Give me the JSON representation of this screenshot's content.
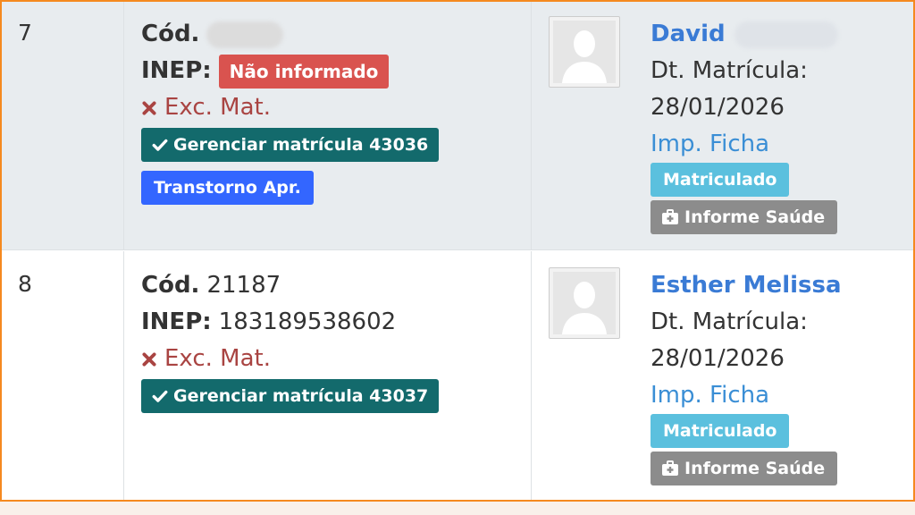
{
  "rows": [
    {
      "index": "7",
      "cod_label": "Cód.",
      "cod_value": "",
      "inep_label": "INEP:",
      "inep_value": "Não informado",
      "exc_label": "Exc. Mat.",
      "manage_button": "Gerenciar matrícula 43036",
      "tag_button": "Transtorno Apr.",
      "student_name": "David",
      "date_label": "Dt. Matrícula:",
      "date_value": "28/01/2026",
      "print_link": "Imp. Ficha",
      "status": "Matriculado",
      "health_button": "Informe Saúde"
    },
    {
      "index": "8",
      "cod_label": "Cód.",
      "cod_value": "21187",
      "inep_label": "INEP:",
      "inep_value": "183189538602",
      "exc_label": "Exc. Mat.",
      "manage_button": "Gerenciar matrícula 43037",
      "student_name": "Esther Melissa",
      "date_label": "Dt. Matrícula:",
      "date_value": "28/01/2026",
      "print_link": "Imp. Ficha",
      "status": "Matriculado",
      "health_button": "Informe Saúde"
    }
  ],
  "colors": {
    "frame_border": "#f5891f",
    "manage_button": "#136a6c",
    "status_badge": "#5bc0de",
    "inep_missing_badge": "#d9534f",
    "tag_button": "#3366ff",
    "health_button": "#8c8c8c",
    "name_link": "#3a7bd5"
  },
  "icons": {
    "exc": "times-icon",
    "manage": "check-icon",
    "health": "medkit-icon",
    "avatar": "user-silhouette-icon"
  }
}
